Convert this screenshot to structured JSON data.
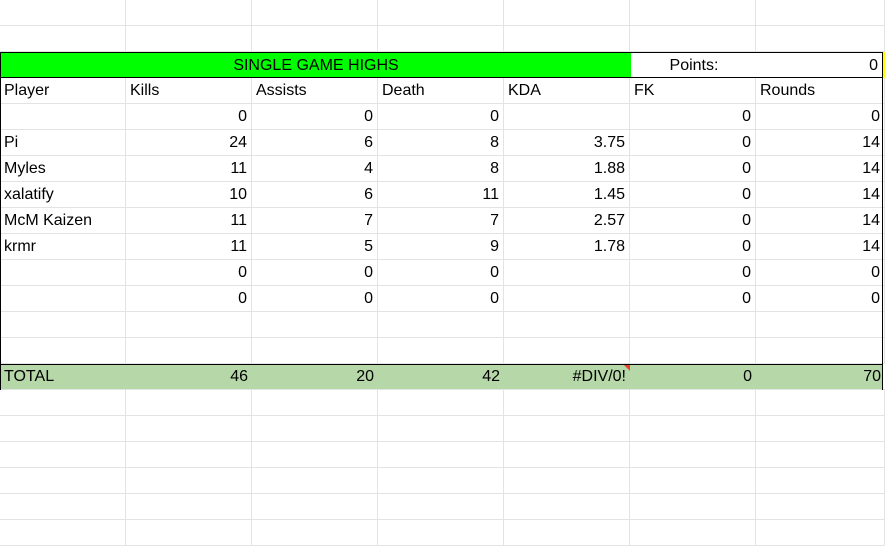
{
  "banner": {
    "title": "SINGLE GAME HIGHS",
    "points_label": "Points:",
    "points_value": "0"
  },
  "headers": [
    "Player",
    "Kills",
    "Assists",
    "Death",
    "KDA",
    "FK",
    "Rounds"
  ],
  "rows": [
    [
      "",
      "0",
      "0",
      "0",
      "",
      "0",
      "0"
    ],
    [
      "Pi",
      "24",
      "6",
      "8",
      "3.75",
      "0",
      "14"
    ],
    [
      "Myles",
      "11",
      "4",
      "8",
      "1.88",
      "0",
      "14"
    ],
    [
      "xalatify",
      "10",
      "6",
      "11",
      "1.45",
      "0",
      "14"
    ],
    [
      "McM Kaizen",
      "11",
      "7",
      "7",
      "2.57",
      "0",
      "14"
    ],
    [
      "krmr",
      "11",
      "5",
      "9",
      "1.78",
      "0",
      "14"
    ],
    [
      "",
      "0",
      "0",
      "0",
      "",
      "0",
      "0"
    ],
    [
      "",
      "0",
      "0",
      "0",
      "",
      "0",
      "0"
    ],
    [
      "",
      "",
      "",
      "",
      "",
      "",
      ""
    ],
    [
      "",
      "",
      "",
      "",
      "",
      "",
      ""
    ]
  ],
  "total": [
    "TOTAL",
    "46",
    "20",
    "42",
    "#DIV/0!",
    "0",
    "70"
  ],
  "colors": {
    "banner_green": "#00ff00",
    "total_green": "#b6d7a8",
    "gridline": "#e2e3e3",
    "error_flag": "#e8412c",
    "points_edge": "#ffff00"
  }
}
